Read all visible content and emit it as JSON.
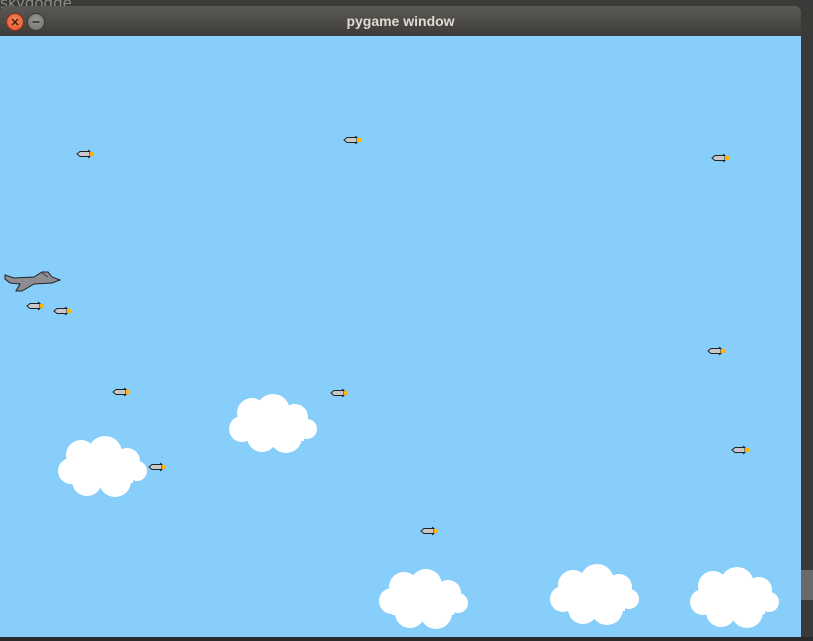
{
  "desktop": {
    "background_text": "skydodge"
  },
  "window": {
    "title": "pygame window",
    "buttons": [
      {
        "name": "close-button",
        "icon": "close-icon"
      },
      {
        "name": "minimize-button",
        "icon": "minimize-icon"
      }
    ]
  },
  "game": {
    "sky_color": "#87CEFA",
    "cloud_color": "#FFFFFF",
    "missile_body_color": "#C8C8CC",
    "missile_flame_color": "#FFB400",
    "jet_color": "#8C8C92",
    "sprites": {
      "player": "jet-icon",
      "enemy": "missile-icon",
      "scenery": "cloud-icon"
    }
  }
}
